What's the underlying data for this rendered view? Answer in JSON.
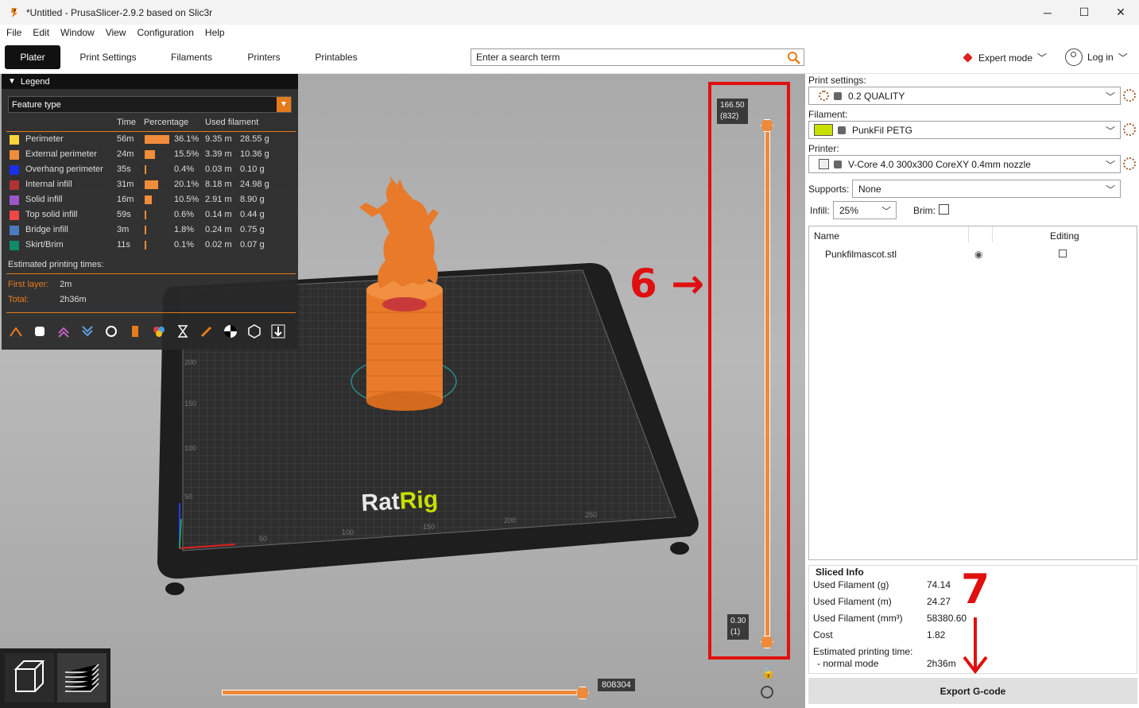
{
  "window": {
    "title": "*Untitled - PrusaSlicer-2.9.2 based on Slic3r",
    "minimize": "─",
    "maximize": "☐",
    "close": "✕"
  },
  "menu": [
    "File",
    "Edit",
    "Window",
    "View",
    "Configuration",
    "Help"
  ],
  "tabs": [
    "Plater",
    "Print Settings",
    "Filaments",
    "Printers",
    "Printables"
  ],
  "search": {
    "placeholder": "Enter a search term"
  },
  "mode": {
    "label": "Expert mode",
    "color": "#e02020"
  },
  "login": {
    "label": "Log in"
  },
  "legend": {
    "title": "Legend",
    "feature_type": "Feature type",
    "headers": {
      "time": "Time",
      "percentage": "Percentage",
      "used": "Used filament"
    },
    "rows": [
      {
        "name": "Perimeter",
        "color": "#f7d63b",
        "time": "56m",
        "pct": "36.1%",
        "pct_value": 36.1,
        "m": "9.35 m",
        "g": "28.55 g"
      },
      {
        "name": "External perimeter",
        "color": "#f08c3a",
        "time": "24m",
        "pct": "15.5%",
        "pct_value": 15.5,
        "m": "3.39 m",
        "g": "10.36 g"
      },
      {
        "name": "Overhang perimeter",
        "color": "#1a2fe8",
        "time": "35s",
        "pct": "0.4%",
        "pct_value": 0.4,
        "m": "0.03 m",
        "g": "0.10 g"
      },
      {
        "name": "Internal infill",
        "color": "#b03232",
        "time": "31m",
        "pct": "20.1%",
        "pct_value": 20.1,
        "m": "8.18 m",
        "g": "24.98 g"
      },
      {
        "name": "Solid infill",
        "color": "#9b56c8",
        "time": "16m",
        "pct": "10.5%",
        "pct_value": 10.5,
        "m": "2.91 m",
        "g": "8.90 g"
      },
      {
        "name": "Top solid infill",
        "color": "#f04646",
        "time": "59s",
        "pct": "0.6%",
        "pct_value": 0.6,
        "m": "0.14 m",
        "g": "0.44 g"
      },
      {
        "name": "Bridge infill",
        "color": "#4a7ac0",
        "time": "3m",
        "pct": "1.8%",
        "pct_value": 1.8,
        "m": "0.24 m",
        "g": "0.75 g"
      },
      {
        "name": "Skirt/Brim",
        "color": "#0f8a6a",
        "time": "11s",
        "pct": "0.1%",
        "pct_value": 0.1,
        "m": "0.02 m",
        "g": "0.07 g"
      }
    ],
    "estimated_label": "Estimated printing times:",
    "first_layer_label": "First layer:",
    "first_layer_value": "2m",
    "total_label": "Total:",
    "total_value": "2h36m"
  },
  "layer_slider": {
    "top": "166.50",
    "top_layer": "(832)",
    "bottom": "0.30",
    "bottom_layer": "(1)",
    "annotation": "6 →"
  },
  "move_slider": {
    "value": "808304"
  },
  "right": {
    "print_settings_label": "Print settings:",
    "print_settings_value": "0.2 QUALITY",
    "filament_label": "Filament:",
    "filament_value": "PunkFil PETG",
    "filament_color": "#c8e000",
    "printer_label": "Printer:",
    "printer_value": "V-Core 4.0 300x300 CoreXY 0.4mm nozzle",
    "supports_label": "Supports:",
    "supports_value": "None",
    "infill_label": "Infill:",
    "infill_value": "25%",
    "brim_label": "Brim:",
    "list_name_header": "Name",
    "list_editing_header": "Editing",
    "object_name": "Punkfilmascot.stl",
    "sliced_title": "Sliced Info",
    "sliced": [
      {
        "label": "Used Filament (g)",
        "value": "74.14"
      },
      {
        "label": "Used Filament (m)",
        "value": "24.27"
      },
      {
        "label": "Used Filament (mm³)",
        "value": "58380.60"
      },
      {
        "label": "Cost",
        "value": "1.82"
      }
    ],
    "est_time_label": "Estimated printing time:",
    "normal_mode_label": "- normal mode",
    "normal_mode_value": "2h36m",
    "export_label": "Export G-code",
    "annotation7": "7"
  },
  "bed": {
    "brand": "RatRig",
    "x_ticks": [
      "50",
      "100",
      "150",
      "200",
      "250"
    ],
    "y_ticks": [
      "50",
      "100",
      "150",
      "200"
    ]
  }
}
